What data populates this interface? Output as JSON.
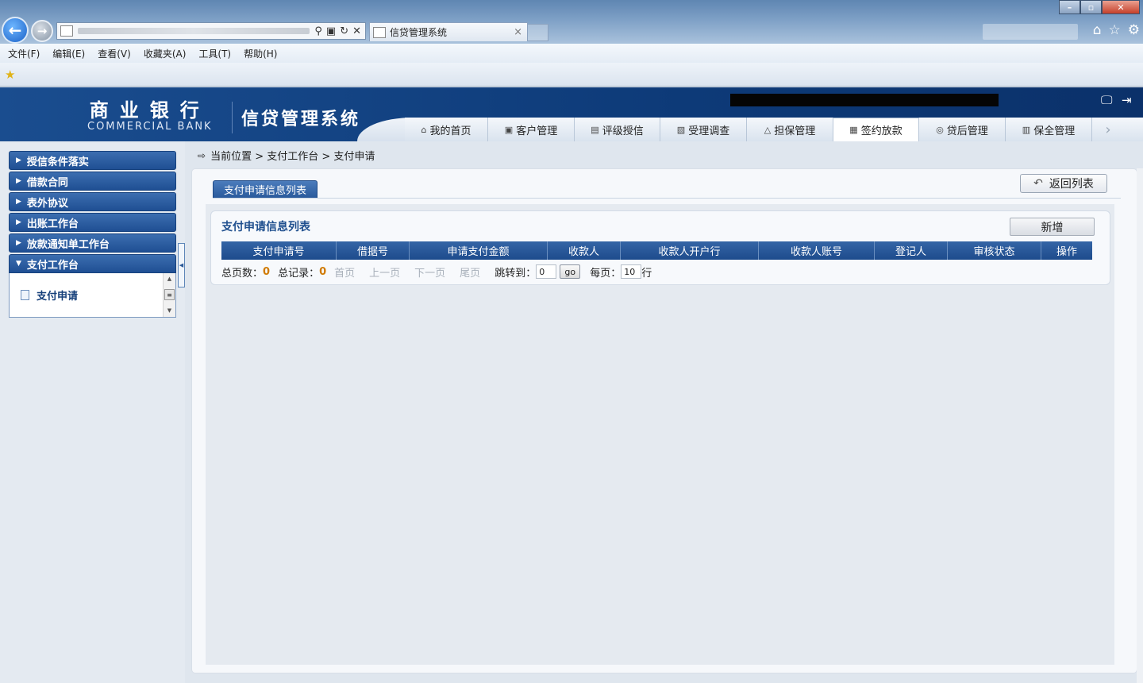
{
  "browser": {
    "tab_title": "信贷管理系统",
    "tab_close": "×",
    "menu": [
      "文件(F)",
      "编辑(E)",
      "查看(V)",
      "收藏夹(A)",
      "工具(T)",
      "帮助(H)"
    ],
    "window_min": "–",
    "window_max": "▫",
    "window_close": "✕"
  },
  "header": {
    "logo_cn": "商业银行",
    "logo_en": "COMMERCIAL BANK",
    "system_title": "信贷管理系统",
    "nav": [
      {
        "label": "我的首页",
        "icon": "home-icon",
        "active": false
      },
      {
        "label": "客户管理",
        "icon": "customer-icon",
        "active": false
      },
      {
        "label": "评级授信",
        "icon": "rating-icon",
        "active": false
      },
      {
        "label": "受理调查",
        "icon": "survey-icon",
        "active": false
      },
      {
        "label": "担保管理",
        "icon": "guarantee-icon",
        "active": false
      },
      {
        "label": "签约放款",
        "icon": "contract-icon",
        "active": true
      },
      {
        "label": "贷后管理",
        "icon": "post-loan-icon",
        "active": false
      },
      {
        "label": "保全管理",
        "icon": "preservation-icon",
        "active": false
      }
    ]
  },
  "sidebar": {
    "items": [
      {
        "label": "授信条件落实",
        "expanded": false
      },
      {
        "label": "借款合同",
        "expanded": false
      },
      {
        "label": "表外协议",
        "expanded": false
      },
      {
        "label": "出账工作台",
        "expanded": false
      },
      {
        "label": "放款通知单工作台",
        "expanded": false
      },
      {
        "label": "支付工作台",
        "expanded": true
      }
    ],
    "sub_item": "支付申请"
  },
  "breadcrumb": {
    "text": "当前位置 > 支付工作台 > 支付申请"
  },
  "main": {
    "tab_label": "支付申请信息列表",
    "back_label": "返回列表",
    "list_title": "支付申请信息列表",
    "add_label": "新增",
    "columns": [
      "支付申请号",
      "借据号",
      "申请支付金额",
      "收款人",
      "收款人开户行",
      "收款人账号",
      "登记人",
      "审核状态",
      "操作"
    ],
    "pager": {
      "total_pages_label": "总页数：",
      "total_pages": "0",
      "total_records_label": "总记录：",
      "total_records": "0",
      "first": "首页",
      "prev": "上一页",
      "next": "下一页",
      "last": "尾页",
      "jump_label": "跳转到：",
      "jump_value": "0",
      "go_label": "go",
      "per_page_label": "每页：",
      "per_page_value": "10",
      "rows_unit": "行"
    }
  },
  "colors": {
    "header_blue": "#0d3a78",
    "table_head": "#1d4b8c",
    "count_orange": "#d07a00"
  }
}
